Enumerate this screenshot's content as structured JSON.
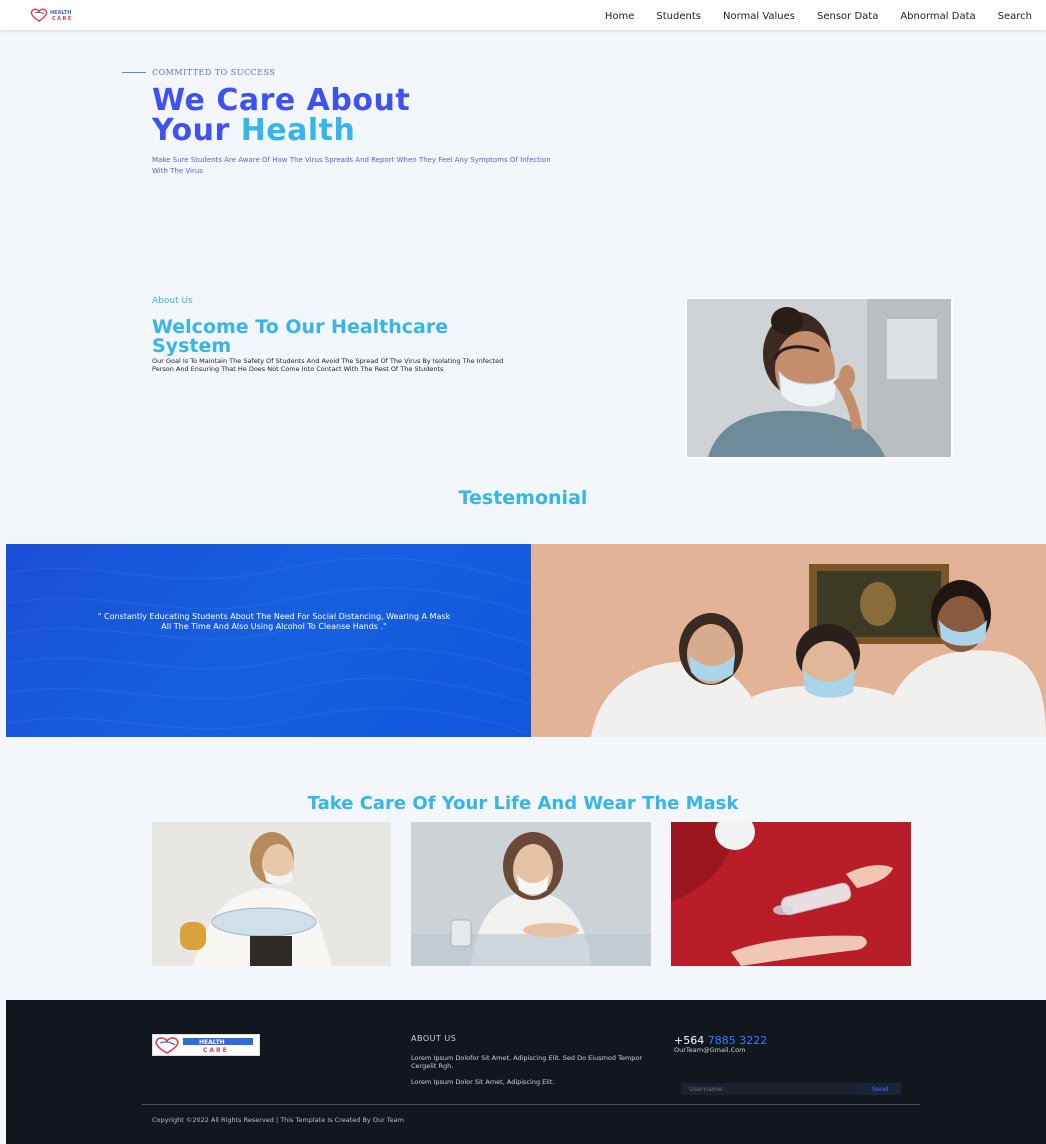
{
  "nav": {
    "logo_text": "HEALTH CARE",
    "links": [
      "Home",
      "Students",
      "Normal Values",
      "Sensor Data",
      "Abnormal Data",
      "Search"
    ]
  },
  "hero": {
    "tag": "COMMITTED TO SUCCESS",
    "title_line1": "We Care About",
    "title_line2_a": "Your",
    "title_line2_b": "Health",
    "description": "Make Sure Students Are Aware Of How The Virus Spreads And Report When They Feel Any Symptoms Of Infection With The Virus"
  },
  "about": {
    "label": "About Us",
    "title": "Welcome To Our Healthcare System",
    "description": "Our Goal Is To Maintain The Safety Of Students And Avoid The Spread Of The Virus By Isolating The Infected Person And Ensuring That He Does Not Come Into Contact With The Rest Of The Students"
  },
  "testimonial": {
    "heading": "Testemonial",
    "quote": "\" Constantly Educating Students About The Need For Social Distancing, Wearing A Mask All The Time And Also Using Alcohol To Cleanse Hands .\""
  },
  "mask_section": {
    "heading": "Take Care Of Your Life And Wear The Mask"
  },
  "footer": {
    "logo_text": "HEALTH CARE",
    "about_title": "ABOUT US",
    "about_text1": "Lorem Ipsum Dolofor Sit Amet, Adipiscing Elit. Sed Do Eiusmod Tempor Cergelit Rgh.",
    "about_text2": "Lorem Ipsum Dolor Sit Amet, Adipiscing Elit.",
    "phone_a": "+564",
    "phone_b": "7885 3222",
    "email": "OurTeam@Gmail.Com",
    "username_placeholder": "Username",
    "send_label": "Send",
    "copyright": "Copyright ©2022 All Rights Reserved | This Template Is Created By Our Team"
  },
  "colors": {
    "primary_blue": "#3f51f5",
    "accent_cyan": "#35b6ea",
    "band_blue": "#1660e0",
    "footer_bg": "#12161f"
  }
}
